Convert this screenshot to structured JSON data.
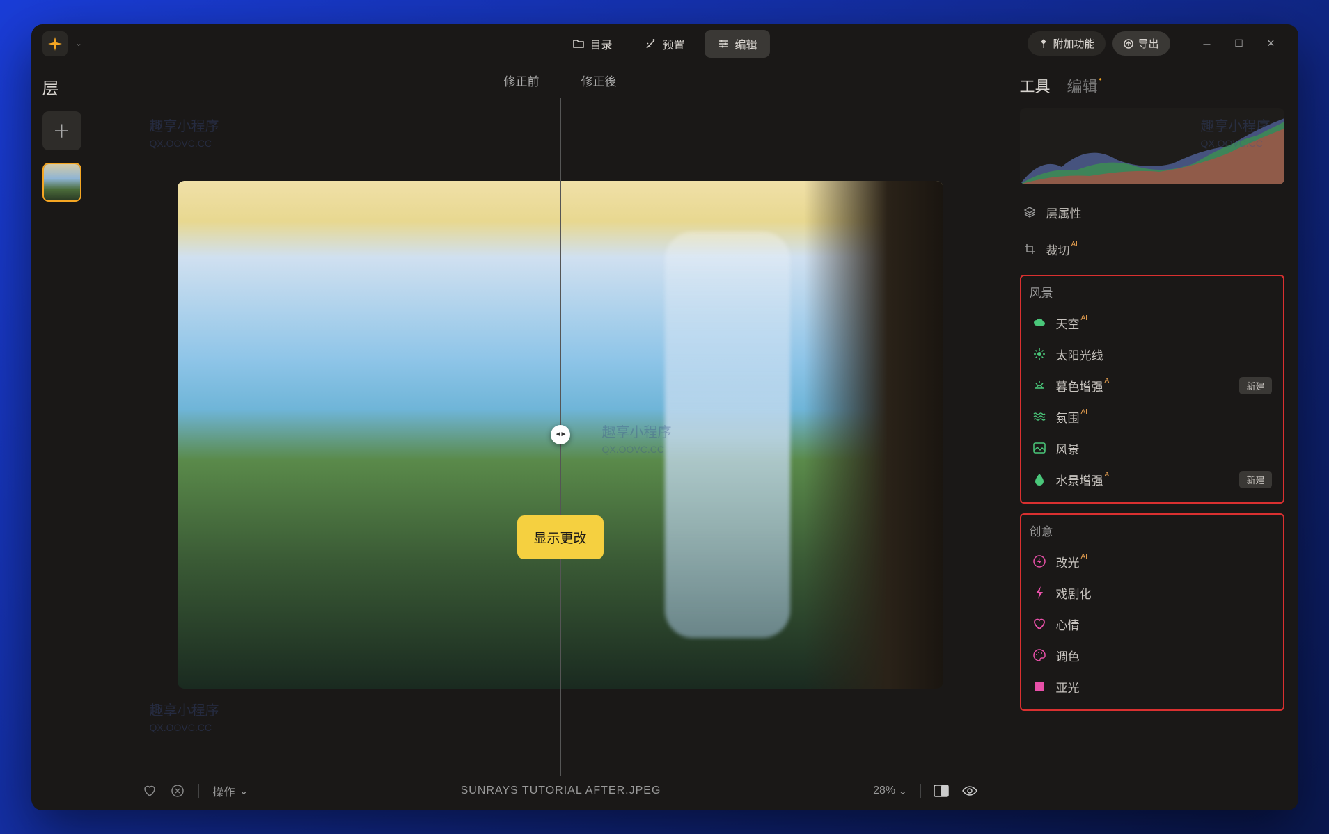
{
  "titlebar": {
    "catalog": "目录",
    "presets": "预置",
    "edit": "编辑",
    "extras": "附加功能",
    "export": "导出"
  },
  "leftPanel": {
    "title": "层"
  },
  "compare": {
    "before": "修正前",
    "after": "修正後",
    "showChanges": "显示更改"
  },
  "bottomBar": {
    "action": "操作",
    "filename": "SUNRAYS TUTORIAL AFTER.JPEG",
    "zoom": "28%"
  },
  "rightPanel": {
    "tabTools": "工具",
    "tabEdit": "编辑",
    "layerProps": "层属性",
    "crop": "裁切",
    "sectionLandscape": "风景",
    "landscape": {
      "sky": "天空",
      "sunrays": "太阳光线",
      "twilight": "暮色增强",
      "atmosphere": "氛围",
      "scenery": "风景",
      "water": "水景增强"
    },
    "sectionCreative": "创意",
    "creative": {
      "relight": "改光",
      "dramatic": "戏剧化",
      "mood": "心情",
      "toning": "调色",
      "matte": "亚光"
    },
    "newBadge": "新建",
    "ai": "AI"
  },
  "watermark": {
    "text": "趣享小程序",
    "url": "QX.OOVC.CC"
  },
  "icons": {
    "logo": "✳",
    "folder": "📁",
    "sparkle": "✦",
    "sliders": "⚙",
    "plus": "＋",
    "heart": "♡",
    "cancel": "⊘",
    "compare": "◨",
    "eye": "👁"
  }
}
